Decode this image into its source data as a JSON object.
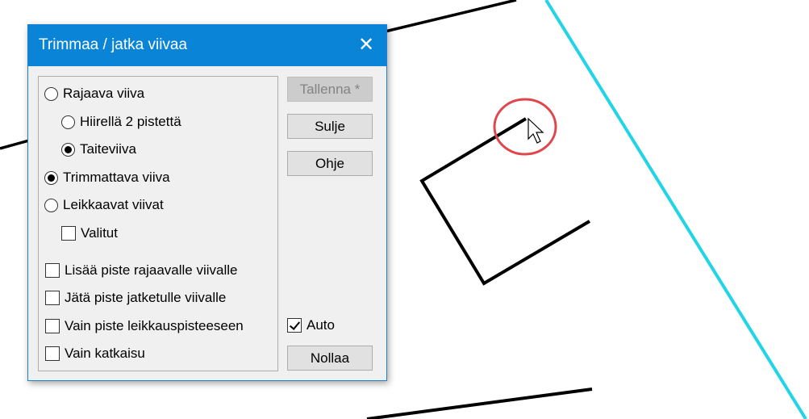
{
  "dialog": {
    "title": "Trimmaa / jatka viivaa",
    "close_glyph": "✕",
    "options": {
      "rajaava": "Rajaava viiva",
      "hiirella": "Hiirellä 2 pistettä",
      "taiteviiva": "Taiteviiva",
      "trimmattava": "Trimmattava viiva",
      "leikkaavat": "Leikkaavat viivat",
      "valitut": "Valitut",
      "lisaa_piste": "Lisää piste rajaavalle viivalle",
      "jata_piste": "Jätä piste jatketulle viivalle",
      "vain_piste": "Vain piste leikkauspisteeseen",
      "vain_katkaisu": "Vain katkaisu"
    },
    "buttons": {
      "tallenna": "Tallenna *",
      "sulje": "Sulje",
      "ohje": "Ohje",
      "nollaa": "Nollaa"
    },
    "auto_label": "Auto"
  },
  "state": {
    "rajaava_selected": false,
    "hiirella_selected": false,
    "taiteviiva_selected": true,
    "trimmattava_selected": true,
    "leikkaavat_selected": false,
    "valitut_checked": false,
    "lisaa_piste_checked": false,
    "jata_piste_checked": false,
    "vain_piste_checked": false,
    "vain_katkaisu_checked": false,
    "auto_checked": true,
    "tallenna_enabled": false
  },
  "colors": {
    "titlebar": "#0a84d6",
    "highlight_circle": "#e0474c",
    "cyan_line": "#21d4e6"
  }
}
